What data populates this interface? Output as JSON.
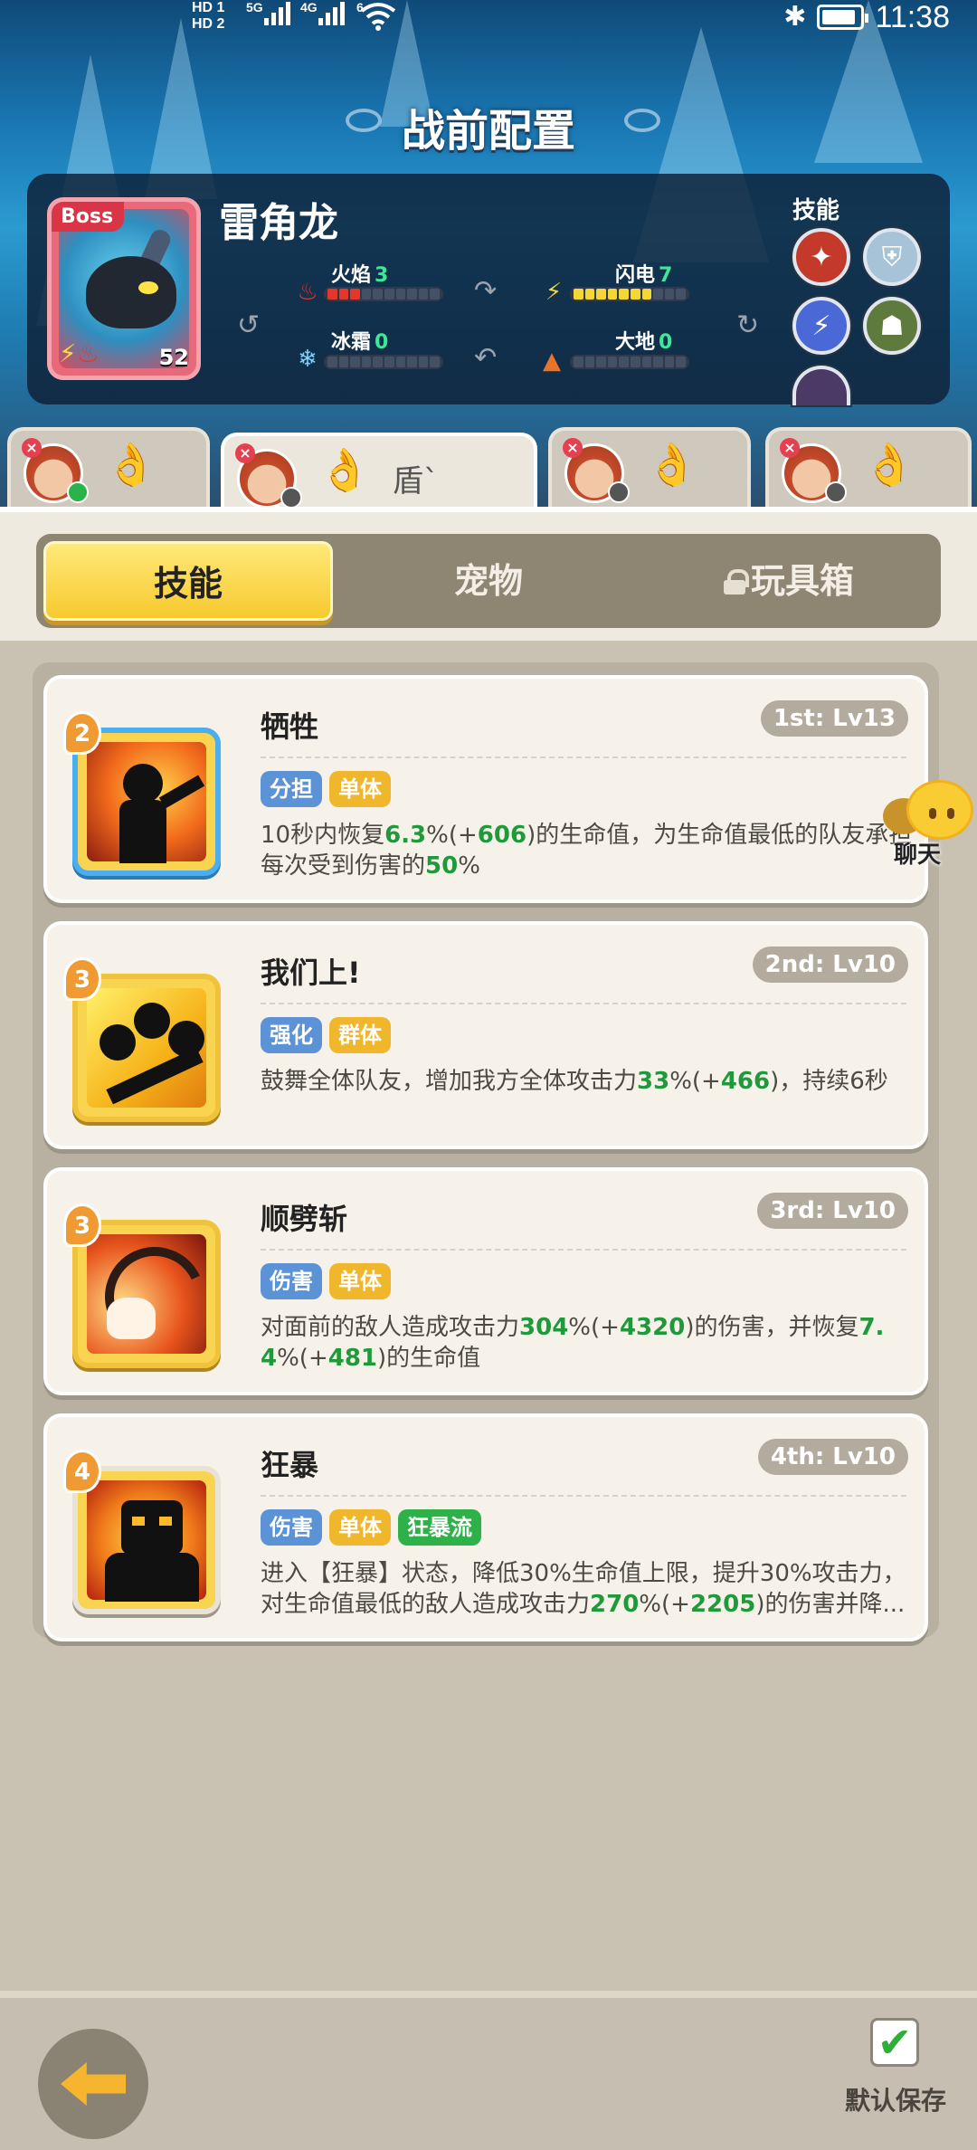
{
  "status_bar": {
    "network_1": "HD 1",
    "network_2": "HD 2",
    "gen_1": "5G",
    "gen_2": "4G",
    "wifi_level": "6",
    "time": "11:38"
  },
  "header": {
    "title": "战前配置"
  },
  "boss": {
    "tag": "Boss",
    "name": "雷角龙",
    "level": "52",
    "stats": [
      {
        "label": "火焰",
        "value": "3",
        "color": "#e5362b",
        "fill": 3,
        "icon": "flame-icon"
      },
      {
        "label": "闪电",
        "value": "7",
        "color": "#f4d635",
        "fill": 7,
        "icon": "lightning-icon"
      },
      {
        "label": "冰霜",
        "value": "0",
        "color": "#7fd4ff",
        "fill": 0,
        "icon": "snowflake-icon"
      },
      {
        "label": "大地",
        "value": "0",
        "color": "#e8742b",
        "fill": 0,
        "icon": "earth-icon"
      }
    ],
    "skills_label": "技能"
  },
  "hero_tabs": [
    {
      "active": false,
      "text": ""
    },
    {
      "active": true,
      "text": "盾`"
    },
    {
      "active": false,
      "text": ""
    },
    {
      "active": false,
      "text": ""
    }
  ],
  "segments": {
    "skills": "技能",
    "pets": "宠物",
    "toybox": "玩具箱"
  },
  "skills": [
    {
      "cost": "2",
      "name": "牺牲",
      "level": "1st: Lv13",
      "tags": [
        {
          "text": "分担",
          "color": "blue"
        },
        {
          "text": "单体",
          "color": "yellow"
        }
      ],
      "desc_parts": [
        {
          "t": "10秒内恢复",
          "g": false
        },
        {
          "t": "6.3",
          "g": true
        },
        {
          "t": "%(+",
          "g": false
        },
        {
          "t": "606",
          "g": true
        },
        {
          "t": ")的生命值，为生命值最低的队友承担每次受到伤害的",
          "g": false
        },
        {
          "t": "50",
          "g": true
        },
        {
          "t": "%",
          "g": false
        }
      ]
    },
    {
      "cost": "3",
      "name": "我们上!",
      "level": "2nd: Lv10",
      "tags": [
        {
          "text": "强化",
          "color": "blue"
        },
        {
          "text": "群体",
          "color": "yellow"
        }
      ],
      "desc_parts": [
        {
          "t": "鼓舞全体队友，增加我方全体攻击力",
          "g": false
        },
        {
          "t": "33",
          "g": true
        },
        {
          "t": "%(+",
          "g": false
        },
        {
          "t": "466",
          "g": true
        },
        {
          "t": ")，持续6秒",
          "g": false
        }
      ]
    },
    {
      "cost": "3",
      "name": "顺劈斩",
      "level": "3rd: Lv10",
      "tags": [
        {
          "text": "伤害",
          "color": "blue"
        },
        {
          "text": "单体",
          "color": "yellow"
        }
      ],
      "desc_parts": [
        {
          "t": "对面前的敌人造成攻击力",
          "g": false
        },
        {
          "t": "304",
          "g": true
        },
        {
          "t": "%(+",
          "g": false
        },
        {
          "t": "4320",
          "g": true
        },
        {
          "t": ")的伤害，并恢复",
          "g": false
        },
        {
          "t": "7.4",
          "g": true
        },
        {
          "t": "%(+",
          "g": false
        },
        {
          "t": "481",
          "g": true
        },
        {
          "t": ")的生命值",
          "g": false
        }
      ]
    },
    {
      "cost": "4",
      "name": "狂暴",
      "level": "4th: Lv10",
      "tags": [
        {
          "text": "伤害",
          "color": "blue"
        },
        {
          "text": "单体",
          "color": "yellow"
        },
        {
          "text": "狂暴流",
          "color": "green"
        }
      ],
      "desc_parts": [
        {
          "t": "进入【狂暴】状态，降低30%生命值上限，提升30%攻击力，对生命值最低的敌人造成攻击力",
          "g": false
        },
        {
          "t": "270",
          "g": true
        },
        {
          "t": "%(+",
          "g": false
        },
        {
          "t": "2205",
          "g": true
        },
        {
          "t": ")的伤害并降...",
          "g": false
        }
      ]
    }
  ],
  "chat": {
    "label": "聊天"
  },
  "footer": {
    "save_label": "默认保存"
  }
}
